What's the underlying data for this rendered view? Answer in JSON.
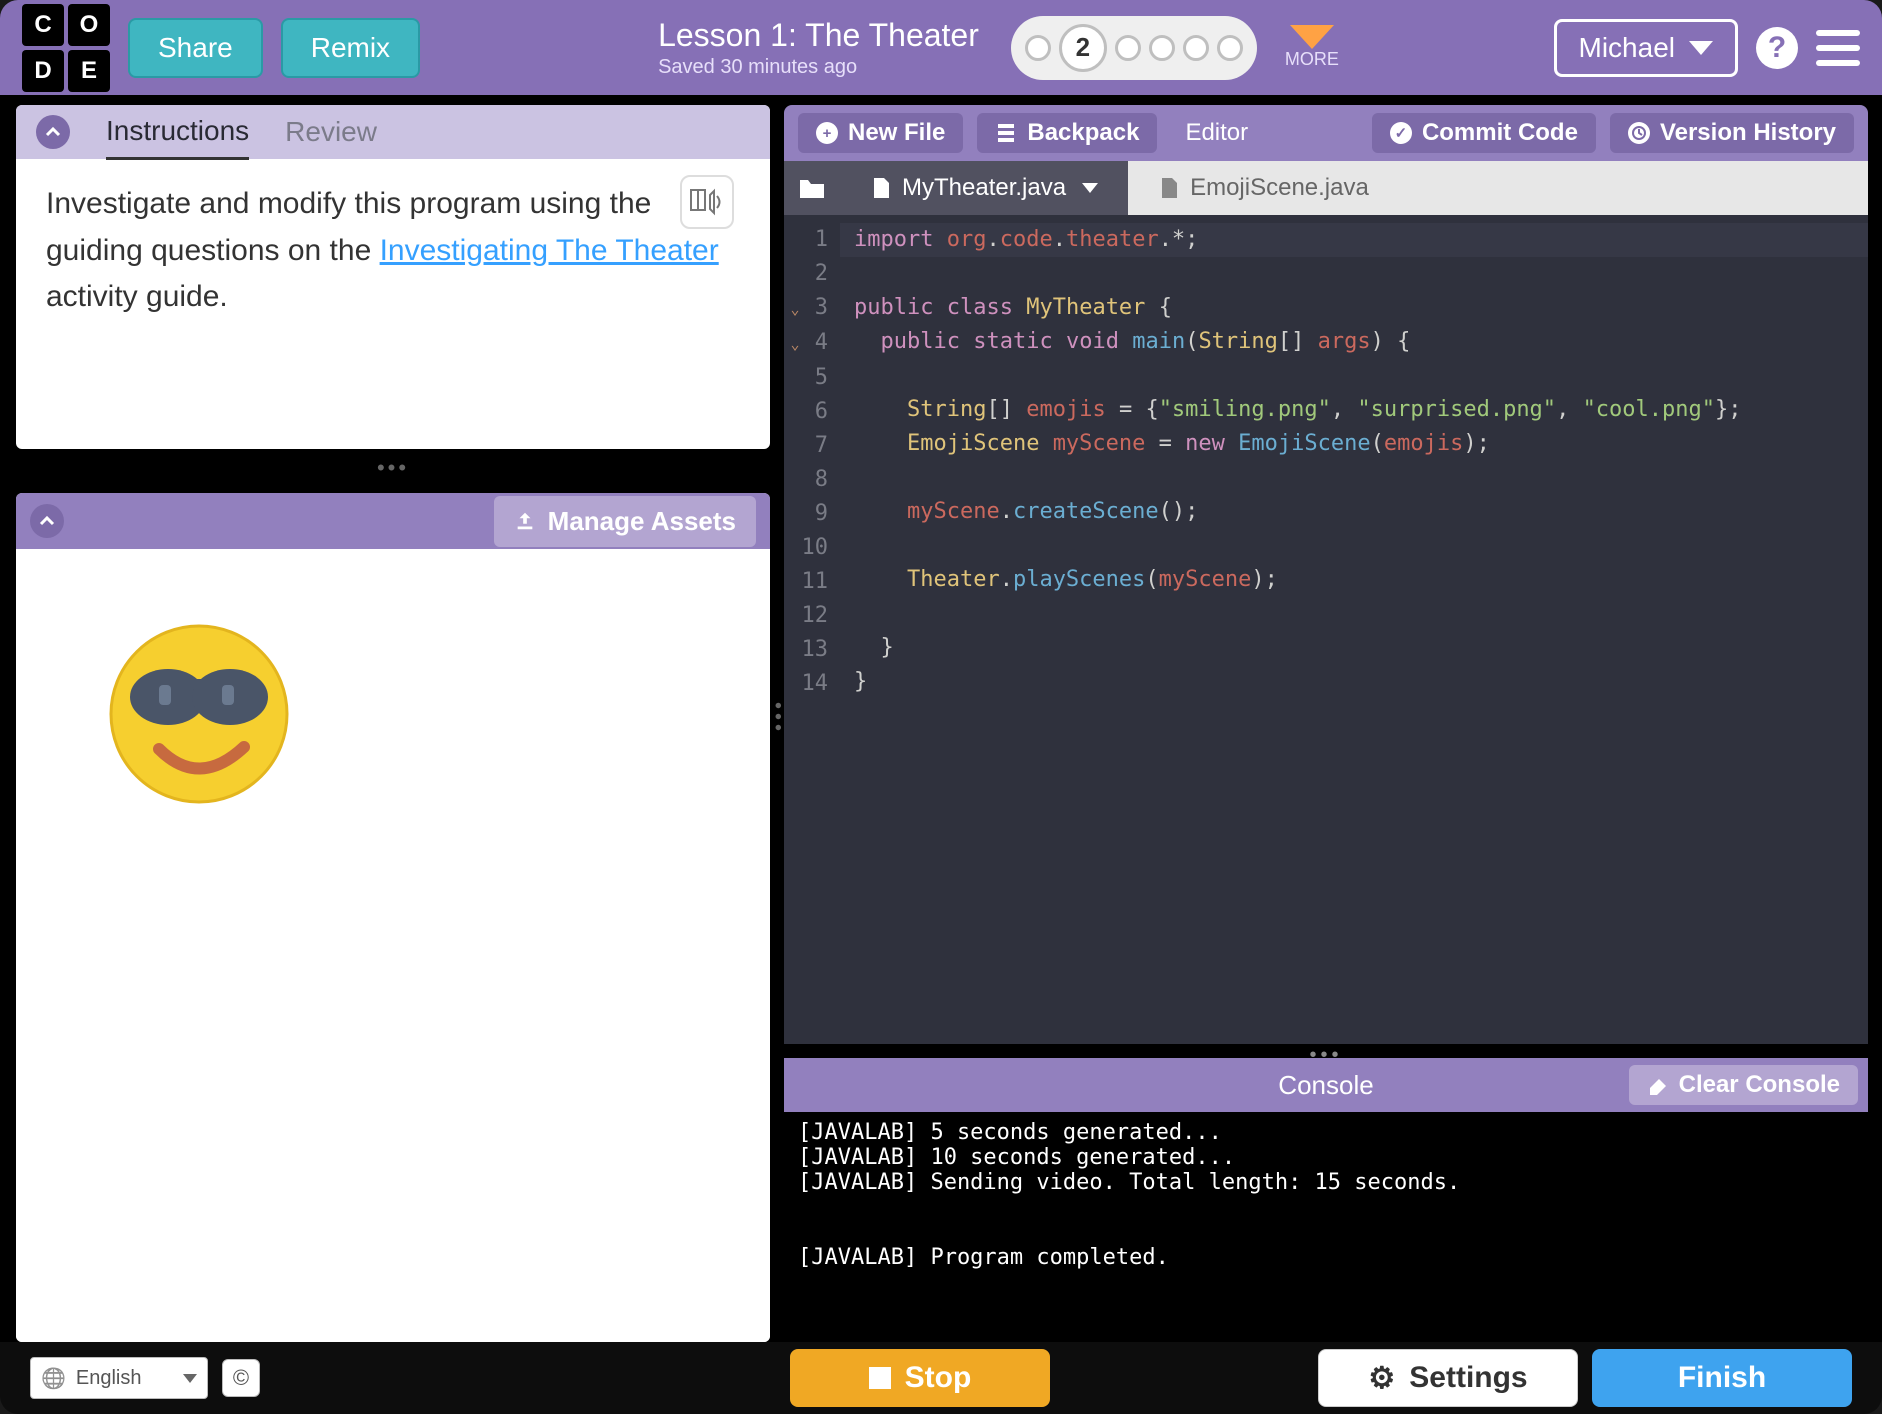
{
  "header": {
    "logo_letters": [
      "C",
      "O",
      "D",
      "E"
    ],
    "share": "Share",
    "remix": "Remix",
    "title": "Lesson 1: The Theater",
    "saved": "Saved 30 minutes ago",
    "progress": {
      "total_dots": 6,
      "active_index": 1,
      "active_label": "2"
    },
    "more": "MORE",
    "user": "Michael"
  },
  "left": {
    "tabs": {
      "instructions": "Instructions",
      "review": "Review"
    },
    "instructions_text_pre": "Investigate and modify this program using the guiding questions on the ",
    "instructions_link": "Investigating The Theater",
    "instructions_text_post": " activity guide.",
    "manage_assets": "Manage Assets"
  },
  "editor_bar": {
    "new_file": "New File",
    "backpack": "Backpack",
    "editor": "Editor",
    "commit": "Commit Code",
    "history": "Version History"
  },
  "files": {
    "active": "MyTheater.java",
    "inactive": "EmojiScene.java"
  },
  "code_lines": [
    {
      "n": "1",
      "html": "<span class='kw'>import</span> <span class='var'>org</span><span class='pln'>.</span><span class='var'>code</span><span class='pln'>.</span><span class='var'>theater</span><span class='pln'>.*;</span>",
      "hl": true
    },
    {
      "n": "2",
      "html": ""
    },
    {
      "n": "3",
      "fold": true,
      "html": "<span class='kw'>public</span> <span class='kw'>class</span> <span class='cls'>MyTheater</span> <span class='pln'>{</span>"
    },
    {
      "n": "4",
      "fold": true,
      "html": "  <span class='kw'>public</span> <span class='kw'>static</span> <span class='kw'>void</span> <span class='mth'>main</span><span class='pln'>(</span><span class='cls'>String</span><span class='pln'>[] </span><span class='var'>args</span><span class='pln'>) {</span>"
    },
    {
      "n": "5",
      "html": ""
    },
    {
      "n": "6",
      "html": "    <span class='cls'>String</span><span class='pln'>[] </span><span class='var'>emojis</span><span class='pln'> = {</span><span class='str'>\"smiling.png\"</span><span class='pln'>, </span><span class='str'>\"surprised.png\"</span><span class='pln'>, </span><span class='str'>\"cool.png\"</span><span class='pln'>};</span>"
    },
    {
      "n": "7",
      "html": "    <span class='cls'>EmojiScene</span> <span class='var'>myScene</span> <span class='pln'>=</span> <span class='kw'>new</span> <span class='mth'>EmojiScene</span><span class='pln'>(</span><span class='var'>emojis</span><span class='pln'>);</span>"
    },
    {
      "n": "8",
      "html": ""
    },
    {
      "n": "9",
      "html": "    <span class='var'>myScene</span><span class='pln'>.</span><span class='mth'>createScene</span><span class='pln'>();</span>"
    },
    {
      "n": "10",
      "html": ""
    },
    {
      "n": "11",
      "html": "    <span class='cls'>Theater</span><span class='pln'>.</span><span class='mth'>playScenes</span><span class='pln'>(</span><span class='var'>myScene</span><span class='pln'>);</span>"
    },
    {
      "n": "12",
      "html": ""
    },
    {
      "n": "13",
      "html": "  <span class='pln'>}</span>"
    },
    {
      "n": "14",
      "html": "<span class='pln'>}</span>"
    }
  ],
  "console": {
    "title": "Console",
    "clear": "Clear Console",
    "lines": [
      "[JAVALAB] 5 seconds generated...",
      "[JAVALAB] 10 seconds generated...",
      "[JAVALAB] Sending video. Total length: 15 seconds.",
      "",
      "",
      "[JAVALAB] Program completed."
    ]
  },
  "bottom": {
    "language": "English",
    "run": "Stop",
    "settings": "Settings",
    "finish": "Finish"
  }
}
